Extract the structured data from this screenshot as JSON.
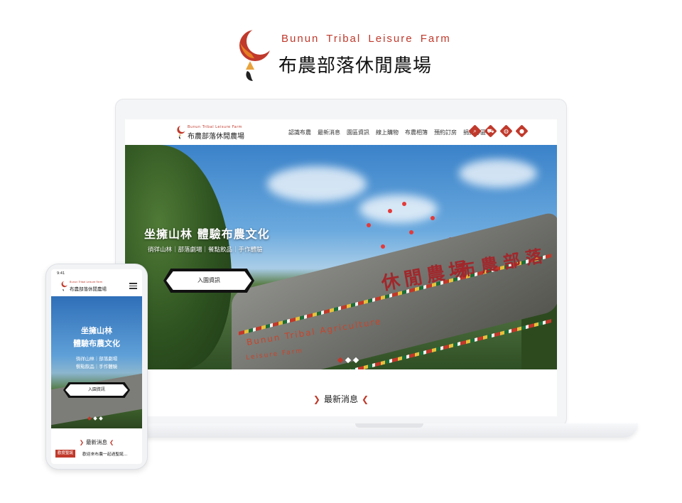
{
  "brand": {
    "name_en": "Bunun Tribal Leisure Farm",
    "name_zh": "布農部落休閒農場"
  },
  "colors": {
    "accent": "#c0392b",
    "text": "#222222",
    "background": "#ffffff"
  },
  "desktop": {
    "nav": [
      "認識布農",
      "最新消息",
      "園區資訊",
      "線上購物",
      "布農相簿",
      "預約訂房",
      "捐款專區"
    ],
    "nav_icons": [
      "search-icon",
      "cart-icon",
      "globe-icon",
      "user-icon"
    ],
    "hero": {
      "headline": "坐擁山林  體驗布農文化",
      "subtitle": "徜徉山林｜部落劇場｜餐點飲品｜手作體驗",
      "enter_button": "入園資訊",
      "sign_text_1": "布農部落",
      "sign_text_2": "休閒農場",
      "sign_en_1": "Bunun Tribal Agriculture",
      "sign_en_2": "Leisure Farm",
      "slides": 3,
      "active_slide": 1
    },
    "news_heading": "最新消息"
  },
  "mobile": {
    "status_time": "9:41",
    "hero": {
      "title_line1": "坐擁山林",
      "title_line2": "體驗布農文化",
      "sub_line1": "徜徉山林｜部落劇場",
      "sub_line2": "餐點飲品｜手作體驗",
      "enter_button": "入園資訊",
      "slides": 3,
      "active_slide": 1
    },
    "news_heading": "最新消息",
    "news_items": [
      {
        "tag": "歡度聖誕",
        "text": "歡迎來布農一起過聖誕..."
      }
    ]
  }
}
